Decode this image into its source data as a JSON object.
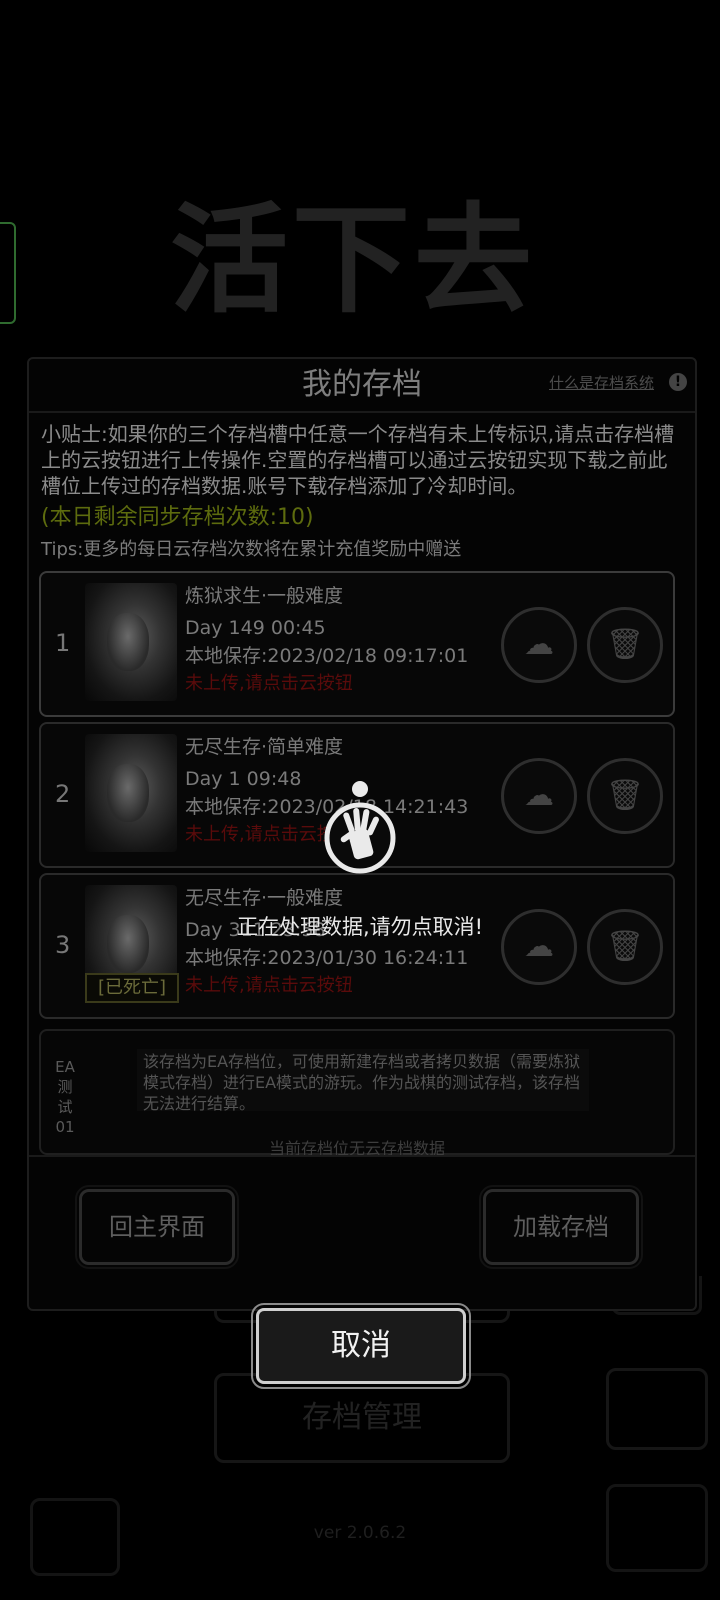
{
  "background": {
    "logo_title": "活下去",
    "logo_subtitle": "",
    "manage_button": "存档管理",
    "version": "ver 2.0.6.2",
    "footer_notice": ""
  },
  "dialog": {
    "title": "我的存档",
    "help_link": "什么是存档系统",
    "tip": "小贴士:如果你的三个存档槽中任意一个存档有未上传标识,请点击存档槽上的云按钮进行上传操作.空置的存档槽可以通过云按钮实现下载之前此槽位上传过的存档数据.账号下载存档添加了冷却时间。",
    "remaining": "(本日剩余同步存档次数:10)",
    "tips_more": "Tips:更多的每日云存档次数将在累计充值奖励中赠送",
    "slots": [
      {
        "num": "1",
        "mode": "炼狱求生·一般难度",
        "day": "Day 149  00:45",
        "saved": "本地保存:2023/02/18  09:17:01",
        "warning": "未上传,请点击云按钮"
      },
      {
        "num": "2",
        "mode": "无尽生存·简单难度",
        "day": "Day 1  09:48",
        "saved": "本地保存:2023/02/18  14:21:43",
        "warning": "未上传,请点击云按钮"
      },
      {
        "num": "3",
        "mode": "无尽生存·一般难度",
        "day": "Day 311  23:58",
        "saved": "本地保存:2023/01/30  16:24:11",
        "warning": "未上传,请点击云按钮",
        "dead_tag": "[已死亡]"
      }
    ],
    "ea_slot": {
      "label": "EA测试01",
      "description": "该存档为EA存档位，可使用新建存档或者拷贝数据（需要炼狱模式存档）进行EA模式的游玩。作为战棋的测试存档，该存档无法进行结算。",
      "no_cloud": "当前存档位无云存档数据"
    },
    "main_menu_button": "回主界面",
    "load_button": "加载存档"
  },
  "overlay": {
    "message": "正在处理数据,请勿点取消!",
    "cancel_button": "取消"
  },
  "icons": {
    "cloud": "cloud-sync-icon",
    "delete": "trash-icon",
    "loader": "zombie-hand-spinner-icon"
  }
}
